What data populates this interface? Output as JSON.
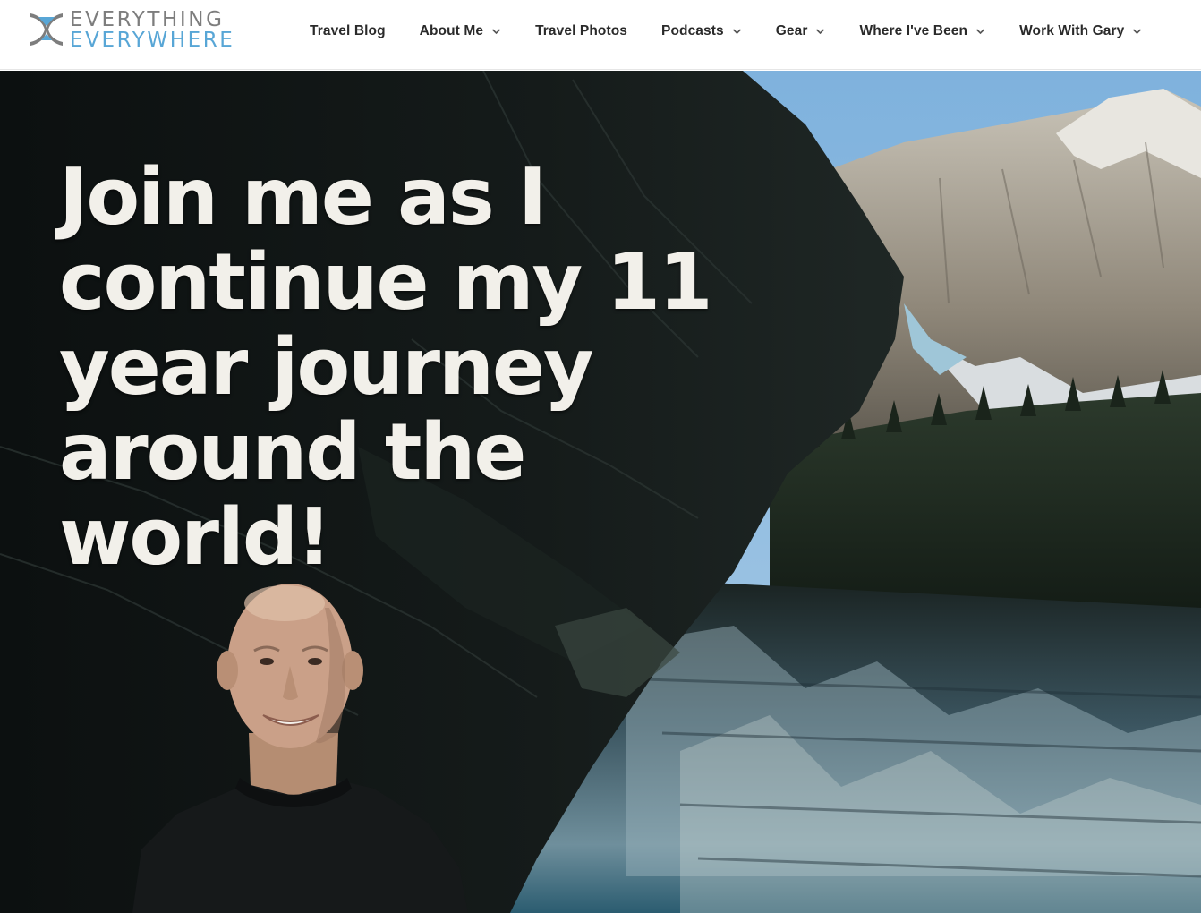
{
  "site": {
    "logo": {
      "line1": "EVERYTHING",
      "line2": "EVERYWHERE",
      "icon": "hourglass-logo-icon",
      "colors": {
        "gray": "#7d7d7d",
        "blue": "#58a6d6"
      }
    }
  },
  "nav": {
    "items": [
      {
        "label": "Travel Blog",
        "has_dropdown": false
      },
      {
        "label": "About Me",
        "has_dropdown": true
      },
      {
        "label": "Travel Photos",
        "has_dropdown": false
      },
      {
        "label": "Podcasts",
        "has_dropdown": true
      },
      {
        "label": "Gear",
        "has_dropdown": true
      },
      {
        "label": "Where I've Been",
        "has_dropdown": true
      },
      {
        "label": "Work With Gary",
        "has_dropdown": true
      }
    ],
    "dropdown_icon": "chevron-down-icon"
  },
  "hero": {
    "headline_lines": [
      "Join me as I",
      "continue my 11",
      "year journey",
      "around the world!"
    ],
    "background": "mountain-lake-landscape",
    "portrait": "smiling-man-portrait"
  }
}
